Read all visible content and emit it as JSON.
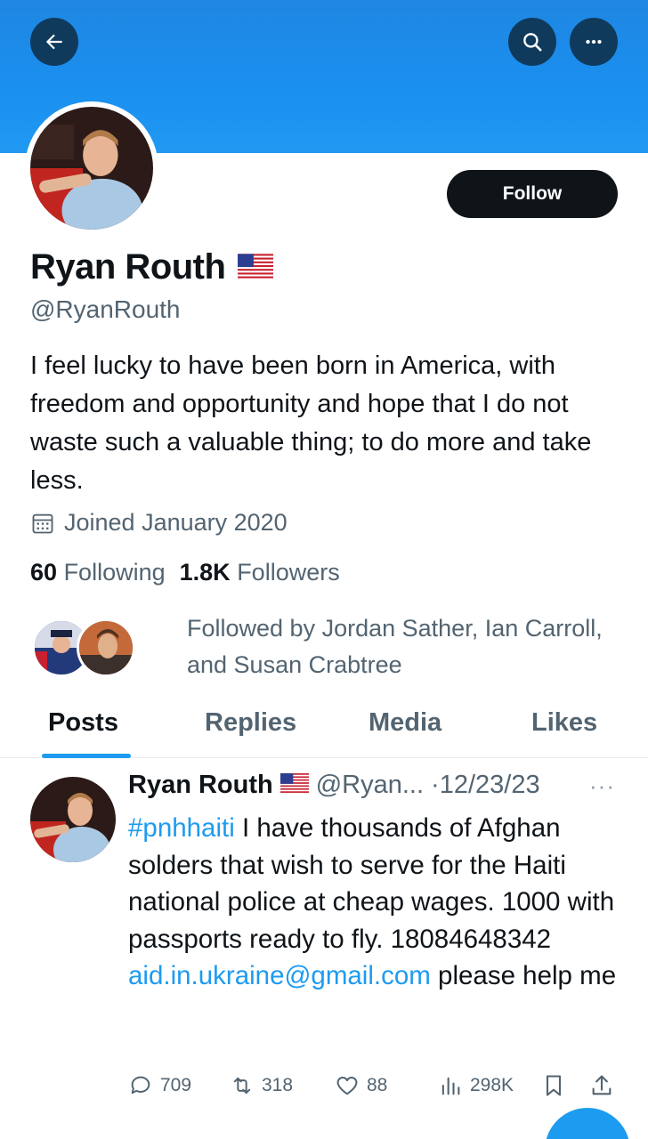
{
  "header": {
    "back_icon": "arrow-left-icon",
    "search_icon": "search-icon",
    "more_icon": "more-horizontal-icon",
    "banner_color": "#1a90f0"
  },
  "profile": {
    "follow_label": "Follow",
    "name": "Ryan Routh",
    "flag": "🇺🇸",
    "handle": "@RyanRouth",
    "bio": "I feel lucky to have been born in America, with freedom and opportunity and hope that I do not waste such a valuable thing; to do more and take less.",
    "joined": "Joined January 2020",
    "following_count": "60",
    "following_label": "Following",
    "followers_count": "1.8K",
    "followers_label": "Followers",
    "followed_by": "Followed by Jordan Sather, Ian Carroll, and Susan Crabtree"
  },
  "tabs": [
    {
      "label": "Posts",
      "active": true
    },
    {
      "label": "Replies",
      "active": false
    },
    {
      "label": "Media",
      "active": false
    },
    {
      "label": "Likes",
      "active": false
    }
  ],
  "post": {
    "name": "Ryan Routh",
    "flag": "🇺🇸",
    "handle": "@Ryan...",
    "date": "·12/23/23",
    "more": "···",
    "hashtag": "#pnhhaiti",
    "text_part1": " I have thousands of Afghan solders that wish to serve for the Haiti national police at cheap wages. 1000 with passports ready to fly. 18084648342 ",
    "email": "aid.in.ukraine@gmail.com",
    "text_part2": " please help me",
    "replies": "709",
    "reposts": "318",
    "likes": "88",
    "views": "298K"
  },
  "colors": {
    "accent": "#1d9bf0",
    "text": "#0f1419",
    "muted": "#536471"
  }
}
